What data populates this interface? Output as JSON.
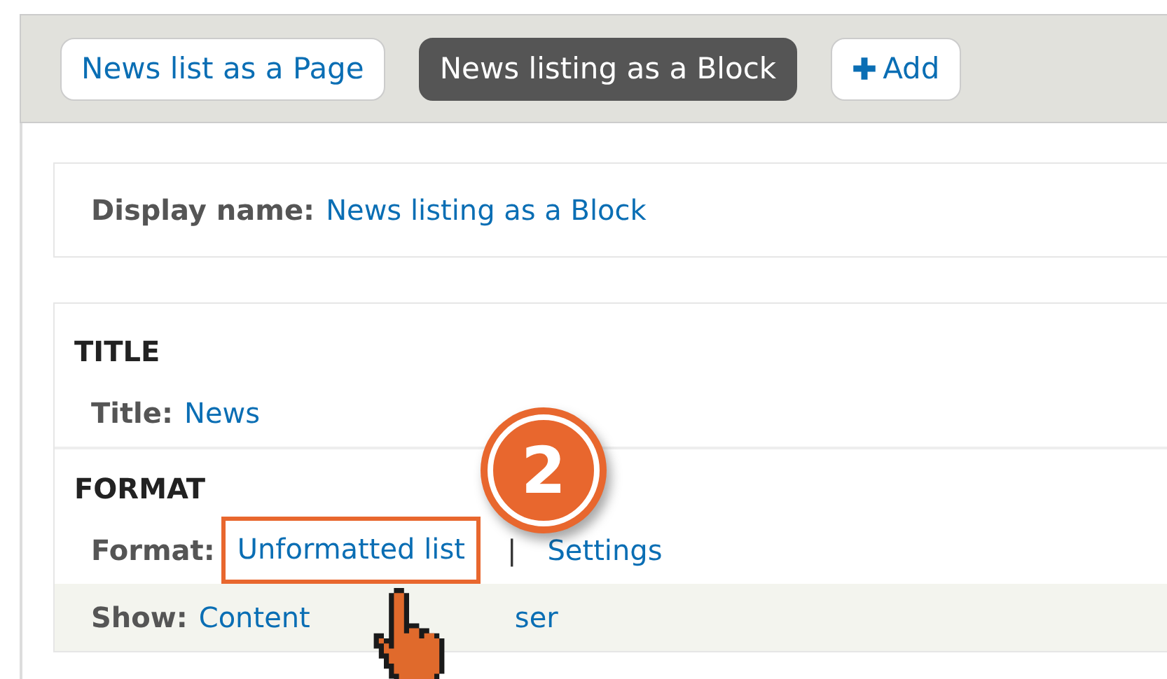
{
  "tabs": [
    {
      "label": "News list as a Page",
      "selected": false,
      "kind": "display"
    },
    {
      "label": "News listing as a Block",
      "selected": true,
      "kind": "display"
    },
    {
      "label": "Add",
      "selected": false,
      "kind": "add"
    }
  ],
  "display_name": {
    "label": "Display name:",
    "value": "News listing as a Block"
  },
  "sections": [
    {
      "heading": "TITLE",
      "rows": [
        {
          "label": "Title:",
          "links": [
            "News"
          ],
          "shaded": false,
          "highlighted": false
        }
      ]
    },
    {
      "heading": "FORMAT",
      "rows": [
        {
          "label": "Format:",
          "links": [
            "Unformatted list",
            "Settings"
          ],
          "separator": "|",
          "shaded": false,
          "highlighted": true
        },
        {
          "label": "Show:",
          "links": [
            "Content",
            "ser"
          ],
          "shaded": true,
          "highlighted": false
        }
      ]
    }
  ],
  "callout": {
    "number": "2"
  }
}
